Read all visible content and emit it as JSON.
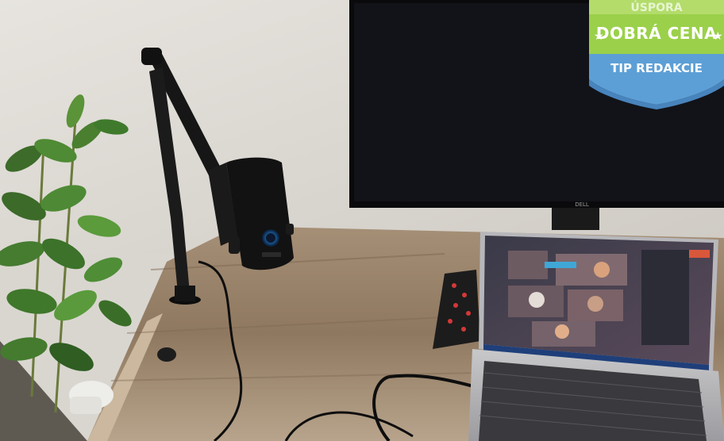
{
  "badge": {
    "top_label": "ÚSPORA",
    "main_label": "DOBRÁ CENA",
    "sub_label": "TIP REDAKCIE",
    "color_top": "#8dc63f",
    "color_bottom": "#5b9bd5"
  },
  "photo": {
    "monitor_brand": "DELL",
    "scene_items": [
      "potted-plant",
      "microphone-boom-arm",
      "microphone",
      "desk-monitor",
      "laptop-video-call",
      "keyboard-controller",
      "desk-clamp",
      "cable"
    ]
  }
}
